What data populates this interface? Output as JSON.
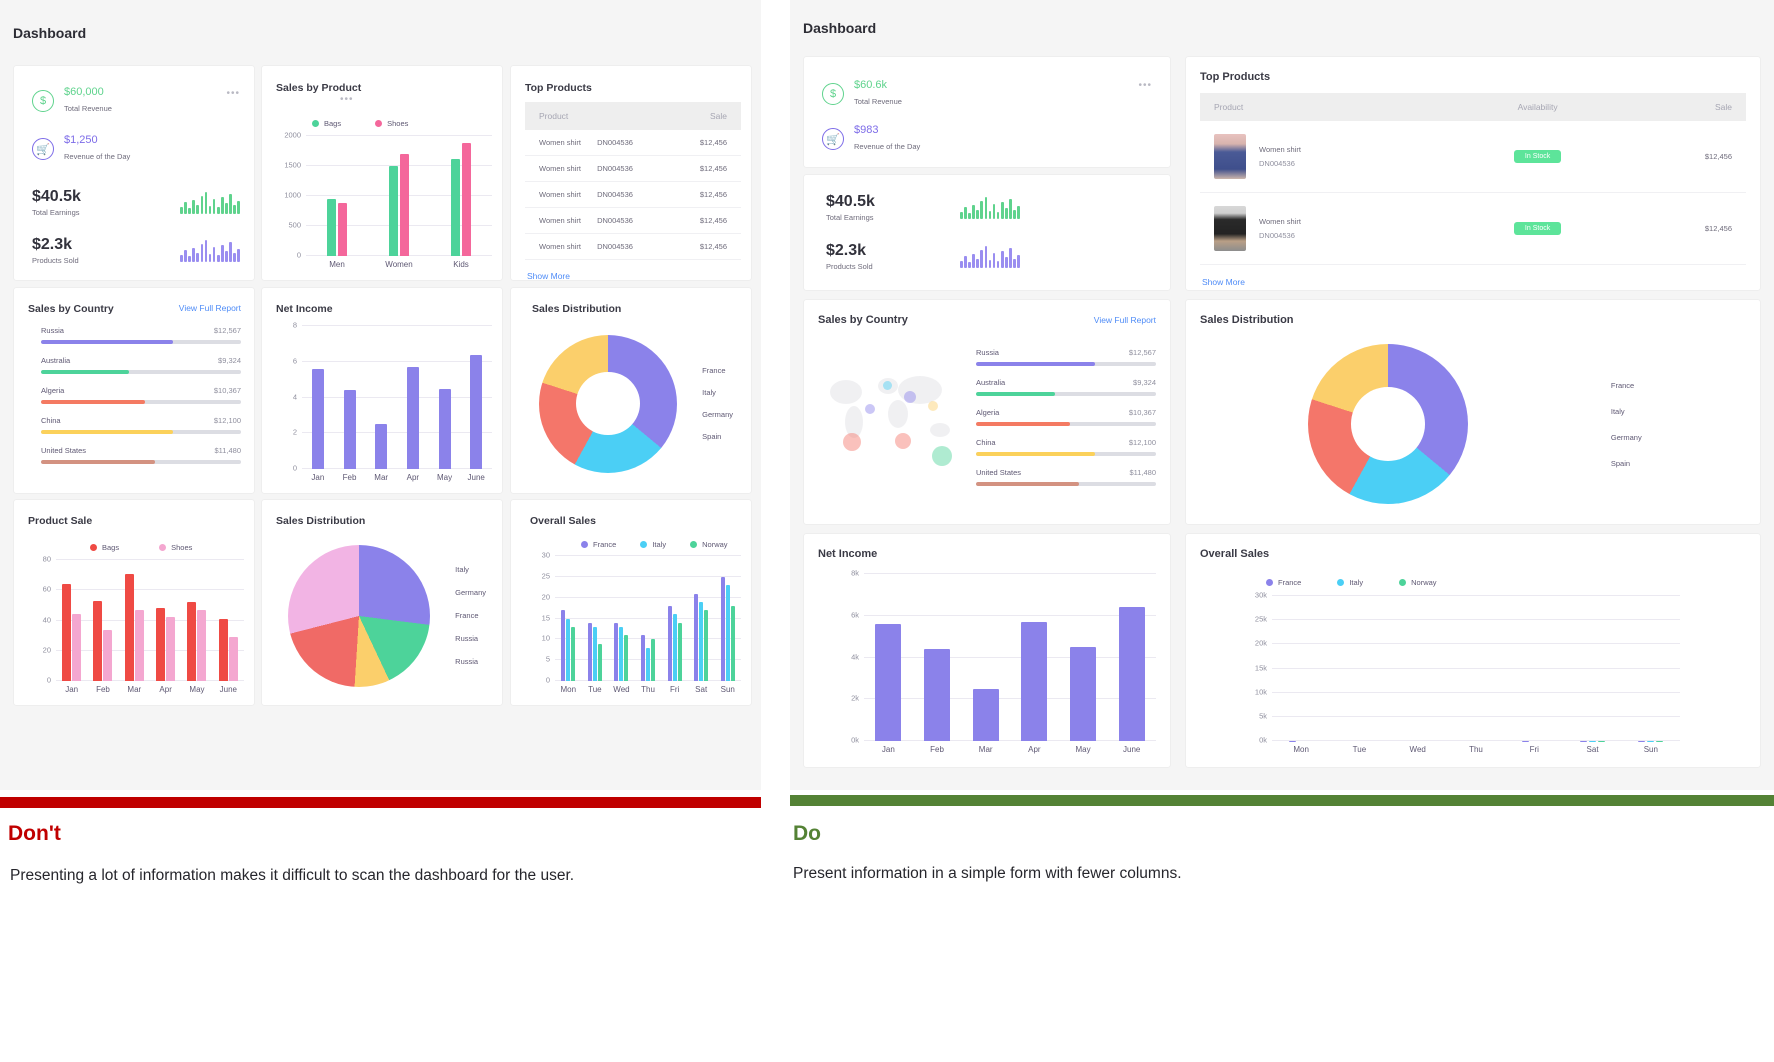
{
  "left_panel": {
    "title": "Dashboard",
    "kpi_card": {
      "revenue": {
        "value": "$60,000",
        "label": "Total Revenue",
        "color": "#5fd38d",
        "icon": "dollar-icon"
      },
      "day": {
        "value": "$1,250",
        "label": "Revenue of the Day",
        "color": "#7d6ce8",
        "icon": "cart-icon"
      },
      "earnings": {
        "value": "$40.5k",
        "label": "Total Earnings",
        "color": "#5fd38d"
      },
      "products": {
        "value": "$2.3k",
        "label": "Products Sold",
        "color": "#9a8ef0"
      },
      "menu": "•••"
    },
    "sales_by_product": {
      "title": "Sales by Product",
      "menu": "•••"
    },
    "top_products": {
      "title": "Top Products",
      "columns": [
        "Product",
        "Sale"
      ],
      "rows": [
        {
          "name": "Women shirt",
          "sku": "DN004536",
          "sale": "$12,456"
        },
        {
          "name": "Women shirt",
          "sku": "DN004536",
          "sale": "$12,456"
        },
        {
          "name": "Women shirt",
          "sku": "DN004536",
          "sale": "$12,456"
        },
        {
          "name": "Women shirt",
          "sku": "DN004536",
          "sale": "$12,456"
        },
        {
          "name": "Women shirt",
          "sku": "DN004536",
          "sale": "$12,456"
        }
      ],
      "show_more": "Show More"
    },
    "sales_by_country": {
      "title": "Sales by Country",
      "action": "View Full Report",
      "rows": [
        {
          "country": "Russia",
          "value": "$12,567",
          "pct": 66,
          "color": "#8b82ea"
        },
        {
          "country": "Australia",
          "value": "$9,324",
          "pct": 44,
          "color": "#4dd39a"
        },
        {
          "country": "Algeria",
          "value": "$10,367",
          "pct": 52,
          "color": "#f47a62"
        },
        {
          "country": "China",
          "value": "$12,100",
          "pct": 66,
          "color": "#fbd15b"
        },
        {
          "country": "United States",
          "value": "$11,480",
          "pct": 57,
          "color": "#d39281"
        }
      ]
    },
    "net_income": {
      "title": "Net Income"
    },
    "sales_distribution_donut": {
      "title": "Sales Distribution"
    },
    "product_sale": {
      "title": "Product Sale"
    },
    "sales_distribution_pie": {
      "title": "Sales Distribution"
    },
    "overall_sales": {
      "title": "Overall Sales"
    }
  },
  "right_panel": {
    "title": "Dashboard",
    "kpi_card": {
      "revenue": {
        "value": "$60.6k",
        "label": "Total Revenue",
        "color": "#5fd38d",
        "icon": "dollar-icon"
      },
      "day": {
        "value": "$983",
        "label": "Revenue of the Day",
        "color": "#7d6ce8",
        "icon": "cart-icon"
      },
      "earnings": {
        "value": "$40.5k",
        "label": "Total Earnings",
        "color": "#5fd38d"
      },
      "products": {
        "value": "$2.3k",
        "label": "Products Sold",
        "color": "#9a8ef0"
      },
      "menu": "•••"
    },
    "top_products": {
      "title": "Top Products",
      "columns": [
        "Product",
        "Availability",
        "Sale"
      ],
      "rows": [
        {
          "name": "Women shirt",
          "sku": "DN004536",
          "availability": "In Stock",
          "sale": "$12,456",
          "thumb": "woman-in-blue-dress"
        },
        {
          "name": "Women shirt",
          "sku": "DN004536",
          "availability": "In Stock",
          "sale": "$12,456",
          "thumb": "woman-in-black-top"
        }
      ],
      "show_more": "Show More"
    },
    "sales_by_country": {
      "title": "Sales by Country",
      "action": "View Full Report",
      "rows": [
        {
          "country": "Russia",
          "value": "$12,567",
          "pct": 66,
          "color": "#8b82ea"
        },
        {
          "country": "Australia",
          "value": "$9,324",
          "pct": 44,
          "color": "#4dd39a"
        },
        {
          "country": "Algeria",
          "value": "$10,367",
          "pct": 52,
          "color": "#f47a62"
        },
        {
          "country": "China",
          "value": "$12,100",
          "pct": 66,
          "color": "#fbd15b"
        },
        {
          "country": "United States",
          "value": "$11,480",
          "pct": 57,
          "color": "#d39281"
        }
      ]
    },
    "sales_distribution": {
      "title": "Sales Distribution"
    },
    "net_income": {
      "title": "Net Income"
    },
    "overall_sales": {
      "title": "Overall Sales"
    }
  },
  "footer": {
    "dont": {
      "label": "Don't",
      "color": "#c00000",
      "text": "Presenting a lot of information makes it difficult to scan the dashboard for the user."
    },
    "do": {
      "label": "Do",
      "color": "#548235",
      "text": "Present information in a simple form with fewer columns."
    }
  },
  "chart_data": [
    {
      "id": "left-sales-by-product",
      "type": "bar",
      "title": "Sales by Product",
      "categories": [
        "Men",
        "Women",
        "Kids"
      ],
      "series": [
        {
          "name": "Bags",
          "color": "#4dd39a",
          "values": [
            950,
            1500,
            1620
          ]
        },
        {
          "name": "Shoes",
          "color": "#f4679b",
          "values": [
            880,
            1700,
            1880
          ]
        }
      ],
      "ylim": [
        0,
        2000
      ],
      "yticks": [
        0,
        500,
        1000,
        1500,
        2000
      ],
      "xlabel": "",
      "ylabel": "",
      "grid": true,
      "legend": "top"
    },
    {
      "id": "left-net-income",
      "type": "bar",
      "title": "Net Income",
      "categories": [
        "Jan",
        "Feb",
        "Mar",
        "Apr",
        "May",
        "June"
      ],
      "series": [
        {
          "name": "Net Income",
          "color": "#8b82ea",
          "values": [
            5.6,
            4.4,
            2.5,
            5.7,
            4.5,
            6.4
          ]
        }
      ],
      "ylim": [
        0,
        8
      ],
      "yticks": [
        0,
        2,
        4,
        6,
        8
      ],
      "xlabel": "",
      "ylabel": "",
      "grid": true,
      "legend": "none"
    },
    {
      "id": "left-sales-distribution-donut",
      "type": "pie",
      "title": "Sales Distribution",
      "labels": [
        "France",
        "Italy",
        "Germany",
        "Spain"
      ],
      "values": [
        36,
        22,
        22,
        20
      ],
      "colors": [
        "#8b82ea",
        "#4bcff5",
        "#f4766a",
        "#fbcf6b"
      ],
      "legend": "right"
    },
    {
      "id": "left-product-sale",
      "type": "bar",
      "title": "Product Sale",
      "categories": [
        "Jan",
        "Feb",
        "Mar",
        "Apr",
        "May",
        "June"
      ],
      "series": [
        {
          "name": "Bags",
          "color": "#ef4a44",
          "values": [
            64,
            53,
            71,
            48,
            52,
            41
          ]
        },
        {
          "name": "Shoes",
          "color": "#f4a7d0",
          "values": [
            44,
            34,
            47,
            42,
            47,
            29
          ]
        }
      ],
      "ylim": [
        0,
        80
      ],
      "yticks": [
        0,
        20,
        40,
        60,
        80
      ],
      "xlabel": "",
      "ylabel": "",
      "grid": true,
      "legend": "top"
    },
    {
      "id": "left-sales-distribution-pie",
      "type": "pie",
      "title": "Sales Distribution",
      "labels": [
        "Italy",
        "Germany",
        "France",
        "Russia",
        "Russia"
      ],
      "values": [
        27,
        16,
        8,
        20,
        29
      ],
      "colors": [
        "#8b82ea",
        "#4dd39a",
        "#fbcf6b",
        "#f06a66",
        "#f2b4e4"
      ],
      "legend": "right"
    },
    {
      "id": "left-overall-sales",
      "type": "bar",
      "title": "Overall Sales",
      "categories": [
        "Mon",
        "Tue",
        "Wed",
        "Thu",
        "Fri",
        "Sat",
        "Sun"
      ],
      "series": [
        {
          "name": "France",
          "color": "#8b82ea",
          "values": [
            17,
            14,
            14,
            11,
            18,
            21,
            25
          ]
        },
        {
          "name": "Italy",
          "color": "#4bcff5",
          "values": [
            15,
            13,
            13,
            8,
            16,
            19,
            23
          ]
        },
        {
          "name": "Norway",
          "color": "#4dd39a",
          "values": [
            13,
            9,
            11,
            10,
            14,
            17,
            18
          ]
        }
      ],
      "ylim": [
        0,
        30
      ],
      "yticks": [
        0,
        5,
        10,
        15,
        20,
        25,
        30
      ],
      "xlabel": "",
      "ylabel": "",
      "grid": true,
      "legend": "top"
    },
    {
      "id": "right-sales-distribution-donut",
      "type": "pie",
      "title": "Sales Distribution",
      "labels": [
        "France",
        "Italy",
        "Germany",
        "Spain"
      ],
      "values": [
        36,
        22,
        22,
        20
      ],
      "colors": [
        "#8b82ea",
        "#4bcff5",
        "#f4766a",
        "#fbcf6b"
      ],
      "legend": "right"
    },
    {
      "id": "right-net-income",
      "type": "bar",
      "title": "Net Income",
      "categories": [
        "Jan",
        "Feb",
        "Mar",
        "Apr",
        "May",
        "June"
      ],
      "series": [
        {
          "name": "Net Income",
          "color": "#8b82ea",
          "values": [
            5600,
            4400,
            2500,
            5700,
            4500,
            6400
          ]
        }
      ],
      "ylim": [
        0,
        8000
      ],
      "yticks": [
        "0k",
        "2k",
        "4k",
        "6k",
        "8k"
      ],
      "xlabel": "",
      "ylabel": "",
      "grid": true,
      "legend": "none"
    },
    {
      "id": "right-overall-sales",
      "type": "bar",
      "title": "Overall Sales",
      "categories": [
        "Mon",
        "Tue",
        "Wed",
        "Thu",
        "Fri",
        "Sat",
        "Sun"
      ],
      "series": [
        {
          "name": "France",
          "color": "#8b82ea",
          "values": [
            17,
            14,
            14,
            11,
            18,
            21,
            25
          ]
        },
        {
          "name": "Italy",
          "color": "#4bcff5",
          "values": [
            15,
            13,
            13,
            8,
            16,
            19,
            23
          ]
        },
        {
          "name": "Norway",
          "color": "#4dd39a",
          "values": [
            13,
            9,
            11,
            10,
            14,
            17,
            18
          ]
        }
      ],
      "ylim": [
        0,
        30000
      ],
      "yticks": [
        "0k",
        "5k",
        "10k",
        "15k",
        "20k",
        "25k",
        "30k"
      ],
      "xlabel": "",
      "ylabel": "",
      "grid": true,
      "legend": "top"
    }
  ]
}
